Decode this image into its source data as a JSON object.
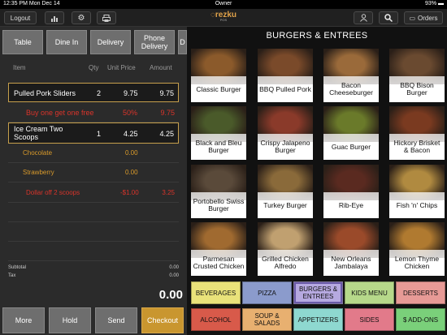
{
  "statusbar": {
    "time": "12:35 PM",
    "date": "Mon Dec 14",
    "user": "Owner",
    "battery": "93%"
  },
  "toolbar": {
    "logout": "Logout",
    "brand": "rezku",
    "brand_sub": "POS",
    "orders": "Orders"
  },
  "order_types": [
    "Table",
    "Dine In",
    "Delivery",
    "Phone Delivery",
    "D"
  ],
  "order_head": {
    "item": "Item",
    "qty": "Qty",
    "unit": "Unit Price",
    "amount": "Amount"
  },
  "order_rows": [
    {
      "kind": "main",
      "name": "Pulled Pork Sliders",
      "qty": "2",
      "unit": "9.75",
      "amount": "9.75"
    },
    {
      "kind": "mod",
      "name": "Buy one get one free",
      "qty": "",
      "unit": "50%",
      "amount": "9.75"
    },
    {
      "kind": "main",
      "name": "Ice Cream Two Scoops",
      "qty": "1",
      "unit": "4.25",
      "amount": "4.25"
    },
    {
      "kind": "opt",
      "name": "Chocolate",
      "qty": "",
      "unit": "0.00",
      "amount": ""
    },
    {
      "kind": "opt",
      "name": "Strawberry",
      "qty": "",
      "unit": "0.00",
      "amount": ""
    },
    {
      "kind": "mod",
      "name": "Dollar off 2 scoops",
      "qty": "",
      "unit": "-$1.00",
      "amount": "3.25"
    }
  ],
  "totals": {
    "subtotal_label": "Subtotal",
    "subtotal": "0.00",
    "tax_label": "Tax",
    "tax": "0.00",
    "grand": "0.00"
  },
  "actions": [
    "More",
    "Hold",
    "Send",
    "Checkout"
  ],
  "category_title": "BURGERS & ENTREES",
  "items": [
    {
      "name": "Classic Burger",
      "icon": "burger-photo",
      "color": "#8b5a2b"
    },
    {
      "name": "BBQ Pulled Pork",
      "icon": "sandwich-photo",
      "color": "#7a4a2a"
    },
    {
      "name": "Bacon Cheeseburger",
      "icon": "burger-photo",
      "color": "#9a6a3a"
    },
    {
      "name": "BBQ Bison Burger",
      "icon": "burger-photo",
      "color": "#6a4a30"
    },
    {
      "name": "Black and Bleu Burger",
      "icon": "burger-photo",
      "color": "#4a5a2a"
    },
    {
      "name": "Crispy Jalapeno Burger",
      "icon": "burger-photo",
      "color": "#8a3a2a"
    },
    {
      "name": "Guac Burger",
      "icon": "burger-photo",
      "color": "#6a7a2a"
    },
    {
      "name": "Hickory Brisket & Bacon",
      "icon": "burger-photo",
      "color": "#7a3a20"
    },
    {
      "name": "Portobello Swiss Burger",
      "icon": "burger-photo",
      "color": "#5a4a3a"
    },
    {
      "name": "Turkey Burger",
      "icon": "burger-photo",
      "color": "#8a6a3a"
    },
    {
      "name": "Rib-Eye",
      "icon": "steak-photo",
      "color": "#5a2a20"
    },
    {
      "name": "Fish 'n' Chips",
      "icon": "fish-photo",
      "color": "#b08a40"
    },
    {
      "name": "Parmesan Crusted Chicken",
      "icon": "chicken-photo",
      "color": "#a06a30"
    },
    {
      "name": "Grilled Chicken Alfredo",
      "icon": "pasta-photo",
      "color": "#c0a070"
    },
    {
      "name": "New Orleans Jambalaya",
      "icon": "rice-photo",
      "color": "#9a4a2a"
    },
    {
      "name": "Lemon Thyme Chicken",
      "icon": "chicken-photo",
      "color": "#b07a30"
    }
  ],
  "categories": [
    {
      "label": "BEVERAGES",
      "color": "#e9e27a"
    },
    {
      "label": "PIZZA",
      "color": "#8b9bcc"
    },
    {
      "label": "BURGERS & ENTREES",
      "color": "#b6a9e0"
    },
    {
      "label": "KIDS MENU",
      "color": "#b6d88a"
    },
    {
      "label": "DESSERTS",
      "color": "#e79a96"
    },
    {
      "label": "ALCOHOL",
      "color": "#d85a4a"
    },
    {
      "label": "SOUP & SALADS",
      "color": "#e8b070"
    },
    {
      "label": "APPETIZERS",
      "color": "#8ed8d0"
    },
    {
      "label": "SIDES",
      "color": "#e27a8a"
    },
    {
      "label": "$ ADD-ONS",
      "color": "#7ad07a"
    }
  ]
}
